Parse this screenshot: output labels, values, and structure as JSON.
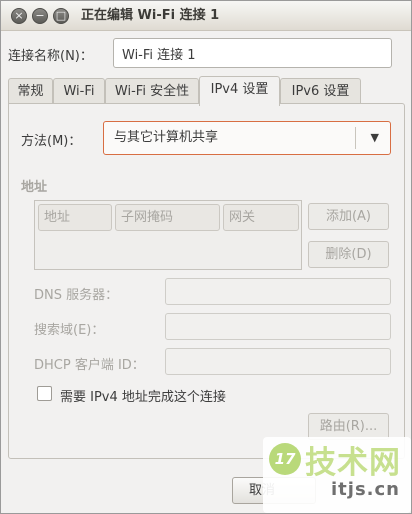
{
  "window": {
    "title": "正在编辑 Wi-Fi 连接 1",
    "close_glyph": "×",
    "minimize_glyph": "−",
    "maximize_glyph": "□"
  },
  "connection_name": {
    "label": "连接名称(N)：",
    "value": "Wi-Fi 连接 1"
  },
  "tabs": [
    {
      "label": "常规",
      "active": false
    },
    {
      "label": "Wi-Fi",
      "active": false
    },
    {
      "label": "Wi-Fi 安全性",
      "active": false
    },
    {
      "label": "IPv4 设置",
      "active": true
    },
    {
      "label": "IPv6 设置",
      "active": false
    }
  ],
  "method": {
    "label": "方法(M)：",
    "value": "与其它计算机共享",
    "arrow_glyph": "▼"
  },
  "address_section": {
    "heading": "地址",
    "columns": [
      "地址",
      "子网掩码",
      "网关"
    ],
    "add_button": "添加(A)",
    "delete_button": "删除(D)"
  },
  "dns": {
    "label": "DNS 服务器：",
    "value": ""
  },
  "search_domains": {
    "label": "搜索域(E)：",
    "value": ""
  },
  "dhcp_client_id": {
    "label": "DHCP 客户端 ID：",
    "value": ""
  },
  "require_ipv4": {
    "label": "需要 IPv4 地址完成这个连接",
    "checked": false
  },
  "routes_button": "路由(R)...",
  "footer": {
    "cancel_button": "取消"
  },
  "watermark": {
    "badge": "17",
    "main": "技术网",
    "domain": "itjs.cn"
  },
  "colors": {
    "accent_border": "#d86e43",
    "watermark_green": "#b9d97a"
  }
}
